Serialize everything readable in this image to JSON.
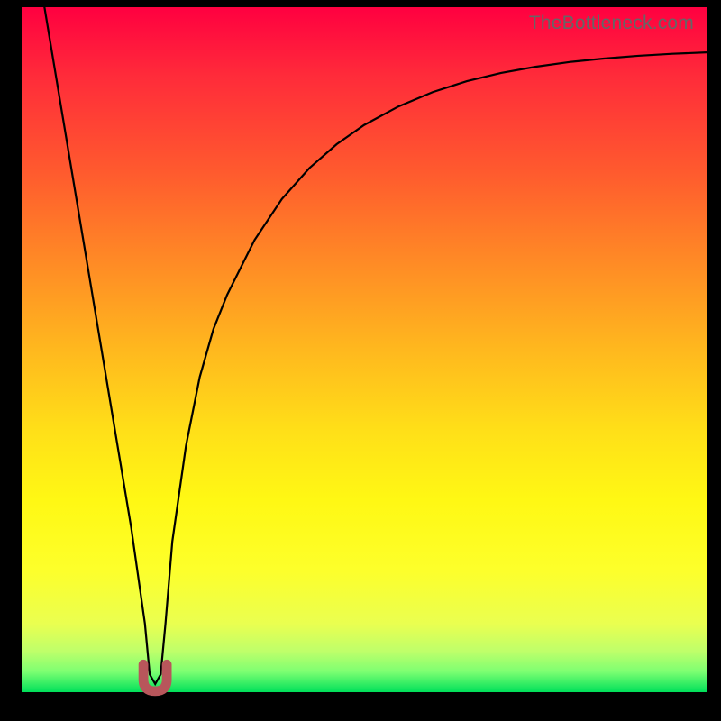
{
  "watermark": "TheBottleneck.com",
  "colors": {
    "frame": "#000000",
    "curve": "#000000",
    "dip_marker": "#b8565b",
    "watermark": "#666666"
  },
  "chart_data": {
    "type": "line",
    "title": "",
    "xlabel": "",
    "ylabel": "",
    "xlim": [
      0,
      100
    ],
    "ylim": [
      0,
      100
    ],
    "series": [
      {
        "name": "bottleneck-curve",
        "x": [
          0,
          2,
          4,
          6,
          8,
          10,
          12,
          14,
          16,
          18,
          18.7,
          19.5,
          20.3,
          21,
          22,
          24,
          26,
          28,
          30,
          34,
          38,
          42,
          46,
          50,
          55,
          60,
          65,
          70,
          75,
          80,
          85,
          90,
          95,
          100
        ],
        "values": [
          120,
          108,
          96,
          84,
          72,
          60,
          48,
          36,
          24,
          10,
          2.6,
          1.2,
          2.6,
          10,
          22,
          36,
          46,
          53,
          58,
          66,
          72,
          76.5,
          80,
          82.8,
          85.5,
          87.6,
          89.2,
          90.4,
          91.3,
          92.0,
          92.5,
          92.9,
          93.2,
          93.4
        ]
      }
    ],
    "annotations": [
      {
        "name": "dip-marker",
        "shape": "U",
        "x": 19.5,
        "y": 1.8,
        "size": 3.8
      }
    ],
    "grid": false,
    "legend": false
  }
}
